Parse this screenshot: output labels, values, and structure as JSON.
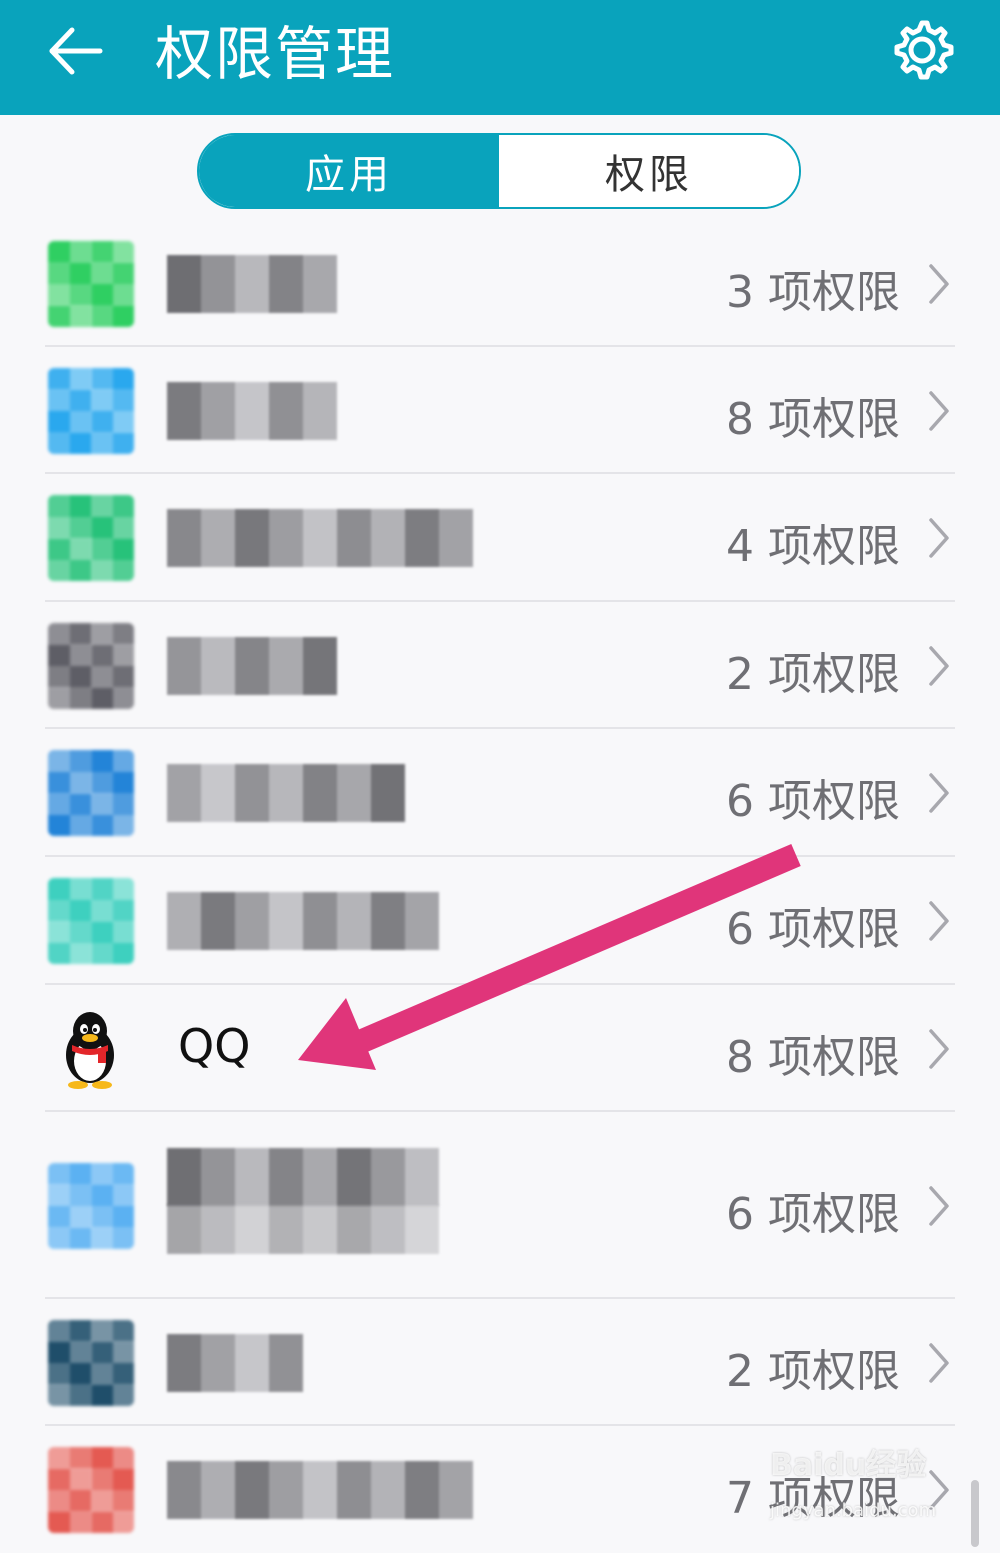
{
  "header": {
    "title": "权限管理",
    "back_icon": "arrow-left-icon",
    "settings_icon": "gear-icon",
    "color": "#09a3bc"
  },
  "segment": {
    "tabs": [
      {
        "label": "应用",
        "active": true
      },
      {
        "label": "权限",
        "active": false
      }
    ]
  },
  "apps": [
    {
      "name": "",
      "blurred": true,
      "permissions": "3 项权限",
      "icon_color": "#2fcf62"
    },
    {
      "name": "",
      "blurred": true,
      "permissions": "8 项权限",
      "icon_color": "#2aa8ee"
    },
    {
      "name": "",
      "blurred": true,
      "permissions": "4 项权限",
      "icon_color": "#27c27a"
    },
    {
      "name": "",
      "blurred": true,
      "permissions": "2 项权限",
      "icon_color": "#5e5e66"
    },
    {
      "name": "",
      "blurred": true,
      "permissions": "6 项权限",
      "icon_color": "#2384d8"
    },
    {
      "name": "",
      "blurred": true,
      "permissions": "6 项权限",
      "icon_color": "#3ed0bf"
    },
    {
      "name": "QQ",
      "blurred": false,
      "permissions": "8 项权限",
      "icon": "qq-penguin-icon"
    },
    {
      "name": "",
      "blurred": true,
      "permissions": "6 项权限",
      "icon_color": "#5bb1f2"
    },
    {
      "name": "",
      "blurred": true,
      "permissions": "2 项权限",
      "icon_color": "#1f4e6a"
    },
    {
      "name": "",
      "blurred": true,
      "permissions": "7 项权限",
      "icon_color": "#e45a52"
    }
  ],
  "watermark": {
    "text": "Baidu经验",
    "sub": "jingyan.baidu.com"
  },
  "annotation": {
    "color": "#e0357a"
  }
}
